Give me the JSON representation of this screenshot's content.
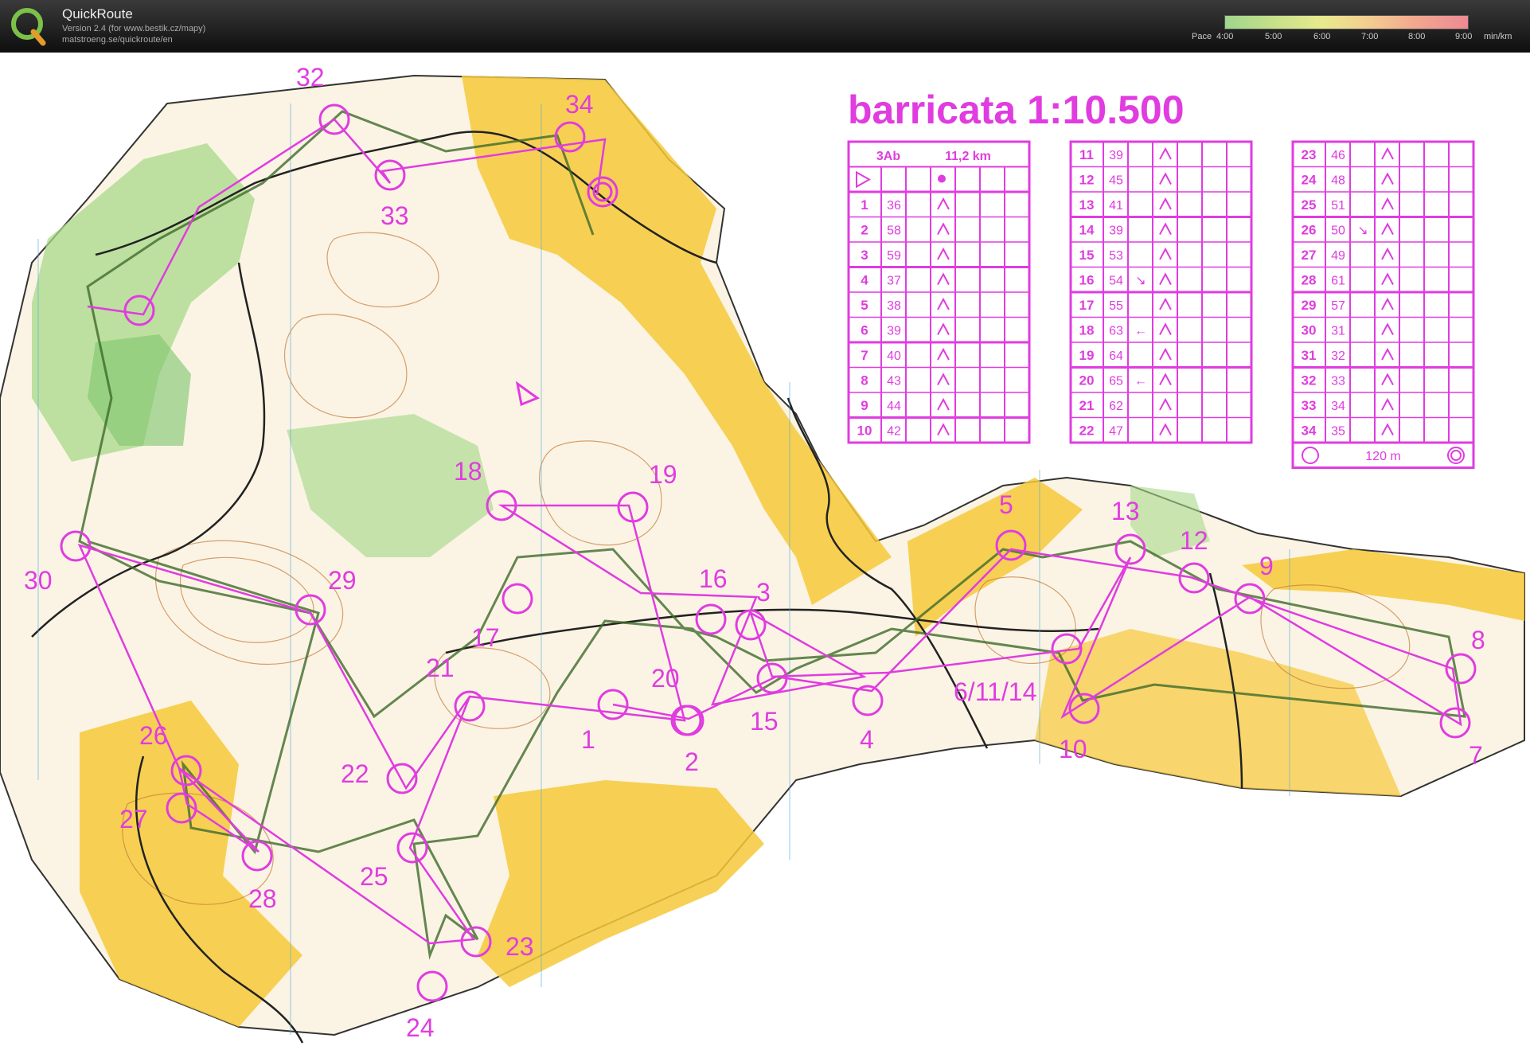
{
  "app": {
    "name": "QuickRoute",
    "version_line": "Version 2.4  (for www.bestik.cz/mapy)",
    "url_line": "matstroeng.se/quickroute/en"
  },
  "pace_scale": {
    "prefix": "Pace",
    "ticks": [
      "4:00",
      "5:00",
      "6:00",
      "7:00",
      "8:00",
      "9:00"
    ],
    "unit": "min/km",
    "colors": [
      "#9fd68c",
      "#e9e98e",
      "#ee8a93"
    ]
  },
  "map": {
    "title": "barricata  1:10.500",
    "course_color": "#e03ce0",
    "controls": [
      {
        "label": "1"
      },
      {
        "label": "2"
      },
      {
        "label": "3"
      },
      {
        "label": "4"
      },
      {
        "label": "5"
      },
      {
        "label": "6/11/14"
      },
      {
        "label": "7"
      },
      {
        "label": "8"
      },
      {
        "label": "9"
      },
      {
        "label": "10"
      },
      {
        "label": "12"
      },
      {
        "label": "13"
      },
      {
        "label": "15"
      },
      {
        "label": "16"
      },
      {
        "label": "17"
      },
      {
        "label": "18"
      },
      {
        "label": "19"
      },
      {
        "label": "20"
      },
      {
        "label": "21"
      },
      {
        "label": "22"
      },
      {
        "label": "23"
      },
      {
        "label": "24"
      },
      {
        "label": "25"
      },
      {
        "label": "26"
      },
      {
        "label": "27"
      },
      {
        "label": "28"
      },
      {
        "label": "29"
      },
      {
        "label": "30"
      },
      {
        "label": "32"
      },
      {
        "label": "33"
      },
      {
        "label": "34"
      }
    ]
  },
  "control_descriptions": {
    "course": "3Ab",
    "length": "11,2 km",
    "finish_distance": "120 m",
    "rows": [
      {
        "num": "1",
        "code": "36",
        "extra": ""
      },
      {
        "num": "2",
        "code": "58",
        "extra": ""
      },
      {
        "num": "3",
        "code": "59",
        "extra": ""
      },
      {
        "num": "4",
        "code": "37",
        "extra": ""
      },
      {
        "num": "5",
        "code": "38",
        "extra": ""
      },
      {
        "num": "6",
        "code": "39",
        "extra": ""
      },
      {
        "num": "7",
        "code": "40",
        "extra": ""
      },
      {
        "num": "8",
        "code": "43",
        "extra": ""
      },
      {
        "num": "9",
        "code": "44",
        "extra": ""
      },
      {
        "num": "10",
        "code": "42",
        "extra": ""
      },
      {
        "num": "11",
        "code": "39",
        "extra": ""
      },
      {
        "num": "12",
        "code": "45",
        "extra": ""
      },
      {
        "num": "13",
        "code": "41",
        "extra": ""
      },
      {
        "num": "14",
        "code": "39",
        "extra": ""
      },
      {
        "num": "15",
        "code": "53",
        "extra": ""
      },
      {
        "num": "16",
        "code": "54",
        "extra": "↘"
      },
      {
        "num": "17",
        "code": "55",
        "extra": ""
      },
      {
        "num": "18",
        "code": "63",
        "extra": "←"
      },
      {
        "num": "19",
        "code": "64",
        "extra": ""
      },
      {
        "num": "20",
        "code": "65",
        "extra": "←"
      },
      {
        "num": "21",
        "code": "62",
        "extra": ""
      },
      {
        "num": "22",
        "code": "47",
        "extra": ""
      },
      {
        "num": "23",
        "code": "46",
        "extra": ""
      },
      {
        "num": "24",
        "code": "48",
        "extra": ""
      },
      {
        "num": "25",
        "code": "51",
        "extra": ""
      },
      {
        "num": "26",
        "code": "50",
        "extra": "↘"
      },
      {
        "num": "27",
        "code": "49",
        "extra": ""
      },
      {
        "num": "28",
        "code": "61",
        "extra": ""
      },
      {
        "num": "29",
        "code": "57",
        "extra": ""
      },
      {
        "num": "30",
        "code": "31",
        "extra": ""
      },
      {
        "num": "31",
        "code": "32",
        "extra": ""
      },
      {
        "num": "32",
        "code": "33",
        "extra": ""
      },
      {
        "num": "33",
        "code": "34",
        "extra": ""
      },
      {
        "num": "34",
        "code": "35",
        "extra": ""
      }
    ]
  }
}
